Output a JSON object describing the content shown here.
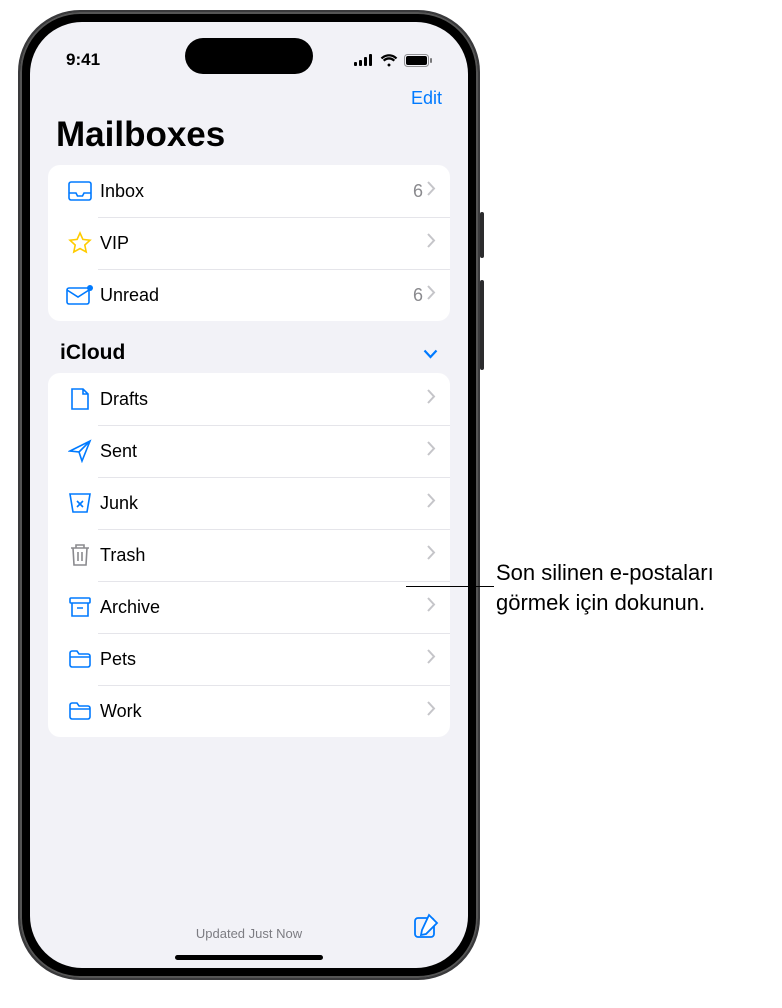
{
  "status": {
    "time": "9:41"
  },
  "nav": {
    "edit": "Edit"
  },
  "title": "Mailboxes",
  "favorites": [
    {
      "icon": "inbox-icon",
      "label": "Inbox",
      "count": "6"
    },
    {
      "icon": "star-icon",
      "label": "VIP",
      "count": ""
    },
    {
      "icon": "unread-icon",
      "label": "Unread",
      "count": "6"
    }
  ],
  "section": {
    "name": "iCloud"
  },
  "icloud": [
    {
      "icon": "drafts-icon",
      "label": "Drafts"
    },
    {
      "icon": "sent-icon",
      "label": "Sent"
    },
    {
      "icon": "junk-icon",
      "label": "Junk"
    },
    {
      "icon": "trash-icon",
      "label": "Trash"
    },
    {
      "icon": "archive-icon",
      "label": "Archive"
    },
    {
      "icon": "folder-icon",
      "label": "Pets"
    },
    {
      "icon": "folder-icon",
      "label": "Work"
    }
  ],
  "footer": {
    "status": "Updated Just Now"
  },
  "callout": {
    "text": "Son silinen e-postaları görmek için dokunun."
  }
}
